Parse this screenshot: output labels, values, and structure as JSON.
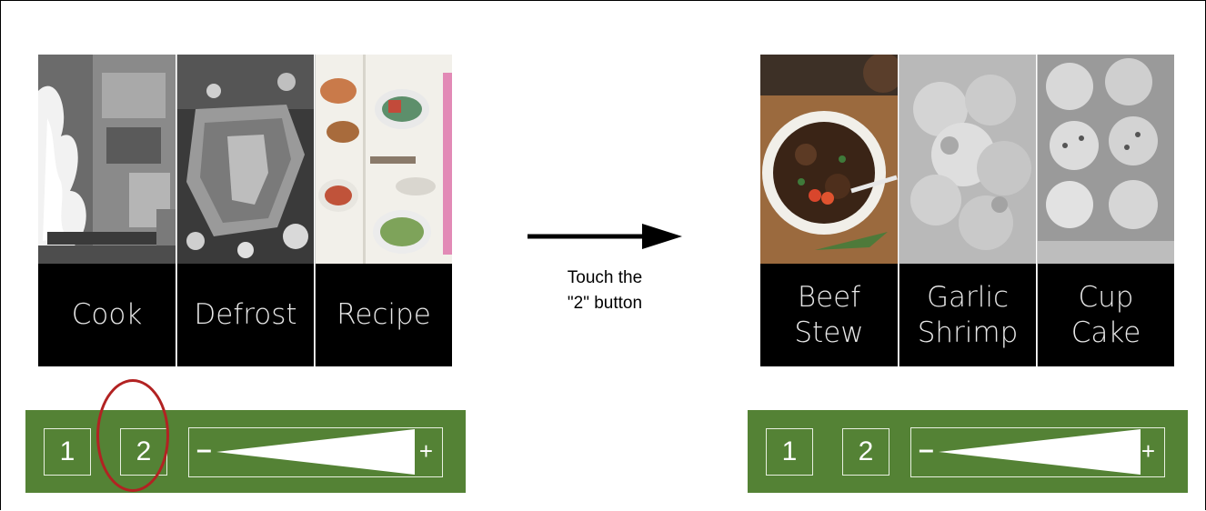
{
  "before": {
    "tiles": [
      {
        "label_line1": "Cook",
        "label_line2": "",
        "image": "chef-flambe-photo"
      },
      {
        "label_line1": "Defrost",
        "label_line2": "",
        "image": "frozen-steak-photo"
      },
      {
        "label_line1": "Recipe",
        "label_line2": "",
        "image": "recipe-book-photo"
      }
    ],
    "buttons": {
      "one": "1",
      "two": "2"
    },
    "slider": {
      "minus": "–",
      "plus": "+",
      "level": 0.85
    }
  },
  "after": {
    "tiles": [
      {
        "label_line1": "Beef",
        "label_line2": "Stew",
        "image": "beef-stew-photo"
      },
      {
        "label_line1": "Garlic",
        "label_line2": "Shrimp",
        "image": "garlic-shrimp-photo"
      },
      {
        "label_line1": "Cup",
        "label_line2": "Cake",
        "image": "cupcake-tray-photo"
      }
    ],
    "buttons": {
      "one": "1",
      "two": "2"
    },
    "slider": {
      "minus": "–",
      "plus": "+",
      "level": 0.88
    }
  },
  "transition": {
    "line1": "Touch the",
    "line2": "\"2\" button"
  },
  "colors": {
    "panel": "#548235",
    "highlight_ring": "#b22222",
    "label_bg": "#000000"
  }
}
